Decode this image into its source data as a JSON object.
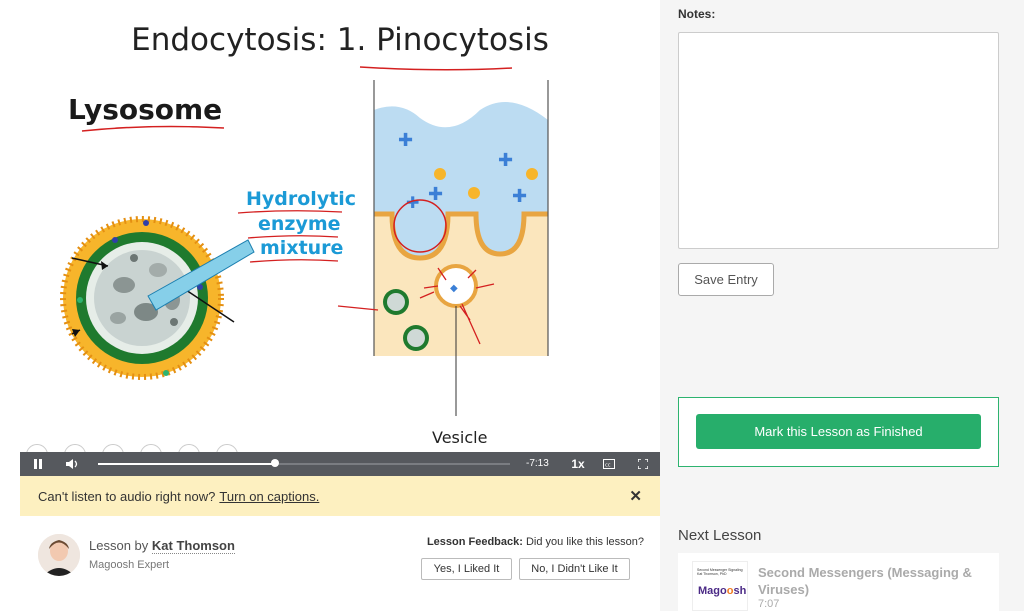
{
  "slide": {
    "title": "Endocytosis: 1. Pinocytosis",
    "annotations": {
      "lysosome": "Lysosome",
      "hydrolytic_line1": "Hydrolytic",
      "hydrolytic_line2": "enzyme",
      "hydrolytic_line3": "mixture",
      "vesicle": "Vesicle"
    }
  },
  "player": {
    "time_remaining": "-7:13",
    "speed": "1x",
    "progress": 0.43,
    "icons": [
      "pause-icon",
      "volume-icon",
      "closed-captions-icon",
      "fullscreen-icon"
    ]
  },
  "caption_banner": {
    "text": "Can't listen to audio right now?",
    "link": "Turn on captions.",
    "close": "✕"
  },
  "lesson": {
    "by_prefix": "Lesson by",
    "author": "Kat Thomson",
    "role": "Magoosh Expert"
  },
  "feedback": {
    "label": "Lesson Feedback:",
    "question": "Did you like this lesson?",
    "yes": "Yes, I Liked It",
    "no": "No, I Didn't Like It"
  },
  "notes": {
    "label": "Notes:",
    "value": "",
    "save": "Save Entry"
  },
  "finish": {
    "label": "Mark this Lesson as Finished"
  },
  "next_lesson": {
    "heading": "Next Lesson",
    "title": "Second Messengers (Messaging & Viruses)",
    "duration": "7:07",
    "thumb_logo_a": "Mago",
    "thumb_logo_b": "o",
    "thumb_logo_c": "sh",
    "thumb_caption_1": "Second Messenger Signaling",
    "thumb_caption_2": "Kat Thomson, PhD"
  },
  "colors": {
    "accent_green": "#27ae6b",
    "banner_yellow": "#fdf0c0",
    "player_gray": "#56595e",
    "annotation_blue": "#1b9ad6",
    "annotation_red": "#d42020"
  }
}
